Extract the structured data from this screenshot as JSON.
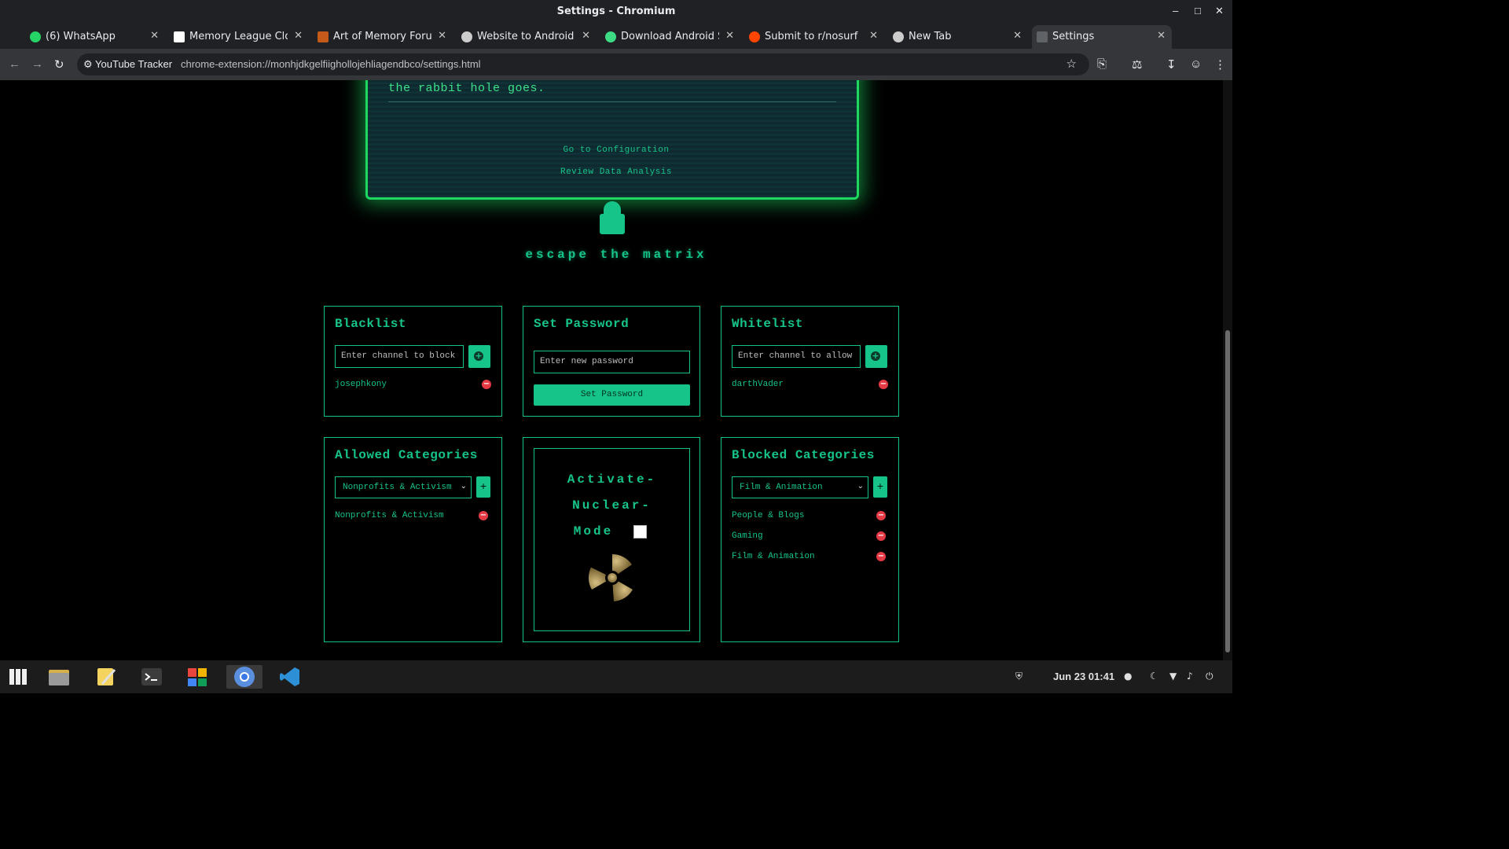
{
  "window": {
    "title": "Settings - Chromium"
  },
  "tabs": [
    {
      "label": "(6) WhatsApp",
      "color": "#25D366"
    },
    {
      "label": "Memory League Clon",
      "color": "#ffffff"
    },
    {
      "label": "Art of Memory Forum",
      "color": "#c45a1a"
    },
    {
      "label": "Website to Android Ap",
      "color": "#cccccc"
    },
    {
      "label": "Download Android St",
      "color": "#3ddc84"
    },
    {
      "label": "Submit to r/nosurf",
      "color": "#ff4500"
    },
    {
      "label": "New Tab",
      "color": "#cccccc"
    },
    {
      "label": "Settings",
      "color": "#5f6368"
    }
  ],
  "toolbar": {
    "chip_label": "YouTube Tracker",
    "url": "chrome-extension://monhjdkgelfiighollojehliagendbco/settings.html"
  },
  "page": {
    "quote_text": "the rabbit hole goes.",
    "links": [
      "Go to Configuration",
      "Review Data Analysis"
    ],
    "escape_title": "escape the matrix",
    "accent_color": "#16c48a"
  },
  "blacklist": {
    "title": "Blacklist",
    "placeholder": "Enter channel to block",
    "items": [
      "josephkony"
    ]
  },
  "password": {
    "title": "Set Password",
    "placeholder": "Enter new password",
    "button": "Set Password"
  },
  "whitelist": {
    "title": "Whitelist",
    "placeholder": "Enter channel to allow",
    "items": [
      "darthVader"
    ]
  },
  "allowed_categories": {
    "title": "Allowed Categories",
    "selected": "Nonprofits & Activism",
    "add_label": "+",
    "items": [
      "Nonprofits & Activism"
    ]
  },
  "nuclear": {
    "lines": [
      "Activate-",
      "Nuclear-",
      "Mode"
    ],
    "checked": false
  },
  "blocked_categories": {
    "title": "Blocked Categories",
    "selected": "Film & Animation",
    "add_label": "+",
    "items": [
      "People & Blogs",
      "Gaming",
      "Film & Animation"
    ]
  },
  "taskbar": {
    "clock": "Jun 23  01:41",
    "apps": [
      "apps-menu-icon",
      "files-icon",
      "text-editor-icon",
      "terminal-icon",
      "software-store-icon",
      "chromium-icon",
      "vscode-icon"
    ]
  }
}
